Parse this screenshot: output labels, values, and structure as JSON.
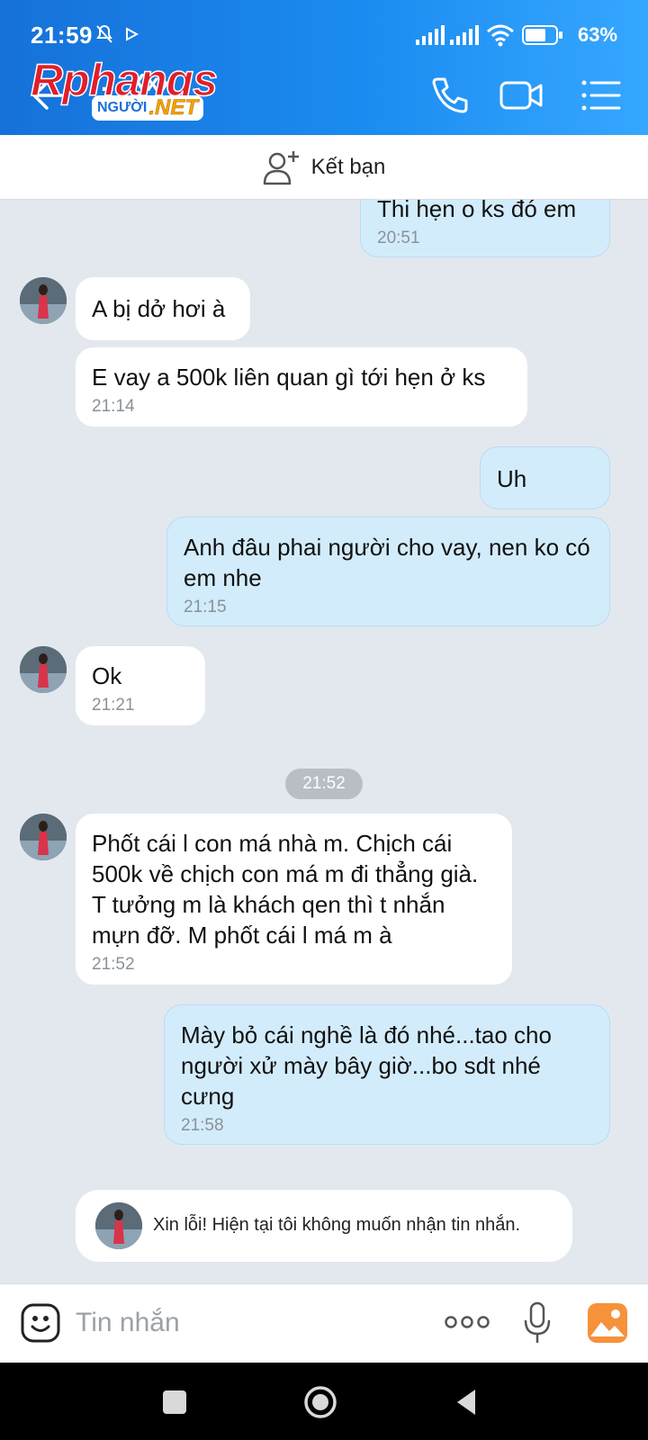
{
  "status_bar": {
    "time": "21:59",
    "battery": "63%"
  },
  "header": {
    "contact_name": "... Xxx",
    "watermark_main": "Rphangs",
    "watermark_sub1": "NGƯỜI",
    "watermark_sub2": ".NET"
  },
  "add_friend": {
    "label": "Kết bạn"
  },
  "messages": [
    {
      "dir": "out",
      "text": "Thi hẹn o ks đó em",
      "time": "20:51"
    },
    {
      "dir": "in",
      "text": "A bị dở hơi à",
      "time": ""
    },
    {
      "dir": "in",
      "text": "E vay a 500k liên quan gì tới hẹn ở ks",
      "time": "21:14"
    },
    {
      "dir": "out",
      "text": "Uh",
      "time": ""
    },
    {
      "dir": "out",
      "text": "Anh đâu phai người cho vay, nen ko có em nhe",
      "time": "21:15"
    },
    {
      "dir": "in",
      "text": "Ok",
      "time": "21:21"
    },
    {
      "dir": "in",
      "text": "Phốt cái l con má nhà m. Chịch cái 500k về chịch con má m đi thẳng già. T tưởng m là khách qen thì t nhắn mựn đỡ. M phốt cái l má m à",
      "time": "21:52"
    },
    {
      "dir": "out",
      "text": "Mày bỏ cái nghề là đó nhé...tao cho người xử mày bây giờ...bo sdt nhé cưng",
      "time": "21:58"
    }
  ],
  "time_divider": "21:52",
  "notice": {
    "text": "Xin lỗi! Hiện tại tôi không muốn nhận tin nhắn."
  },
  "composer": {
    "placeholder": "Tin nhắn"
  },
  "icons": {
    "back": "arrow-left-icon",
    "call": "phone-icon",
    "video": "video-camera-icon",
    "menu": "list-menu-icon",
    "add_friend": "add-person-icon",
    "emoji": "emoji-icon",
    "more": "more-dots-icon",
    "mic": "microphone-icon",
    "gallery": "image-gallery-icon"
  },
  "colors": {
    "header_start": "#1671d9",
    "header_end": "#36a7ff",
    "outgoing_bubble": "#d3ecfb",
    "incoming_bubble": "#ffffff",
    "chat_bg": "#e3e8ef"
  }
}
